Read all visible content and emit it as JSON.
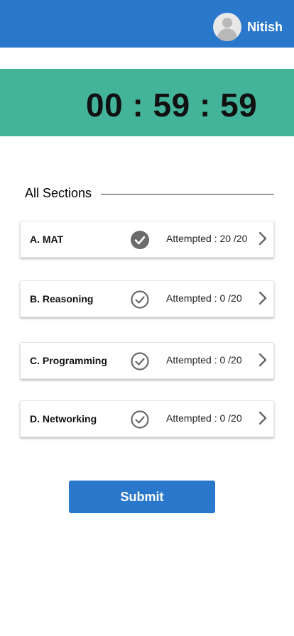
{
  "header": {
    "username": "Nitish"
  },
  "timer": {
    "display": "00 : 59 : 59"
  },
  "sections": {
    "title": "All Sections",
    "items": [
      {
        "label": "A.  MAT",
        "attempted": "Attempted : 20 /20",
        "completed": true
      },
      {
        "label": "B.  Reasoning",
        "attempted": "Attempted : 0 /20",
        "completed": false
      },
      {
        "label": "C.  Programming",
        "attempted": "Attempted : 0 /20",
        "completed": false
      },
      {
        "label": "D.  Networking",
        "attempted": "Attempted : 0 /20",
        "completed": false
      }
    ]
  },
  "submit_label": "Submit",
  "colors": {
    "header": "#2a78cc",
    "timer_band": "#43b39a",
    "check_done": "#6b6b6b",
    "check_pending": "#6b6b6b"
  },
  "icons": {
    "avatar": "avatar-icon",
    "check_filled": "check-circle-filled-icon",
    "check_outline": "check-circle-outline-icon",
    "chevron": "chevron-right-icon"
  }
}
